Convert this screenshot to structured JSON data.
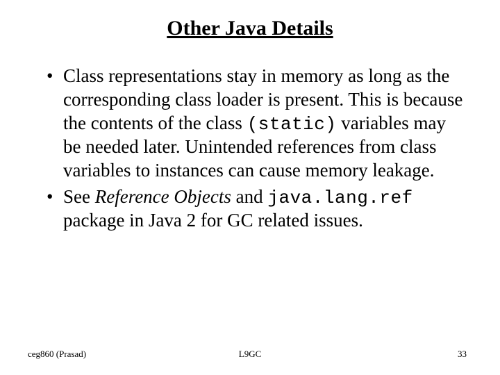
{
  "title": "Other Java Details",
  "bullets": [
    {
      "pre1": "Class representations stay in memory as long as the corresponding class loader is present. This is because the contents of the class ",
      "code1": "(static)",
      "post1": " variables may be needed later. Unintended references from class variables to instances can cause memory leakage."
    },
    {
      "pre1": "See ",
      "ital1": "Reference Objects",
      "mid1": "  and  ",
      "code1": "java.lang.ref",
      "post1": " package in Java 2 for GC related issues."
    }
  ],
  "footer": {
    "left": "ceg860 (Prasad)",
    "center": "L9GC",
    "right": "33"
  }
}
